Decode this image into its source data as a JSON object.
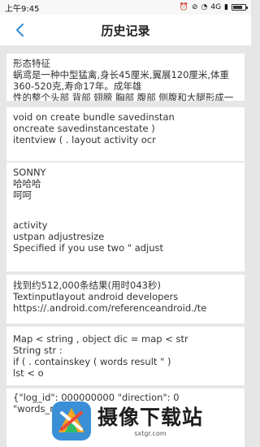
{
  "status_bar": {
    "time": "上午9:45",
    "signal_label": "4G",
    "battery_level": 0.8
  },
  "header": {
    "title": "历史记录",
    "back_icon": "chevron-left-icon"
  },
  "records": [
    {
      "lines": [
        "形态特征",
        "蜗鸢是一种中型猛禽,身长45厘米,翼展120厘米,体重360-520克,寿命17年。成年雄",
        "性的整个头部 背部 翅膀 胸部 腹部 侧腹和大腿形成一"
      ]
    },
    {
      "lines": [
        "void on create bundle savedinstan",
        "oncreate savedinstancestate )",
        "itentview ( . layout activity ocr"
      ]
    },
    {
      "lines": [
        "SONNY",
        "哈哈哈",
        "",
        "呵呵"
      ]
    },
    {
      "lines": [
        "activity",
        "ustpan adjustresize",
        "Specified if you use two \" adjust"
      ]
    },
    {
      "lines": [
        "找到约512,000条结果(用时043秒)",
        "Textinputlayout android developers",
        "https://.android.com/referenceandroid./te"
      ]
    },
    {
      "lines": [
        "Map < string , object dic = map < str",
        "String str :",
        "if ( . containskey ( words result \" )",
        "lst < o"
      ]
    },
    {
      "lines": [
        "{\"log_id\": 000000000 \"direction\": 0",
        "\"words_r"
      ]
    }
  ],
  "watermark": {
    "title": "摄像下载站",
    "url": "sxtgr.com"
  },
  "colors": {
    "accent": "#3a8fd6",
    "background": "#e6e6e6",
    "card": "#ffffff"
  }
}
